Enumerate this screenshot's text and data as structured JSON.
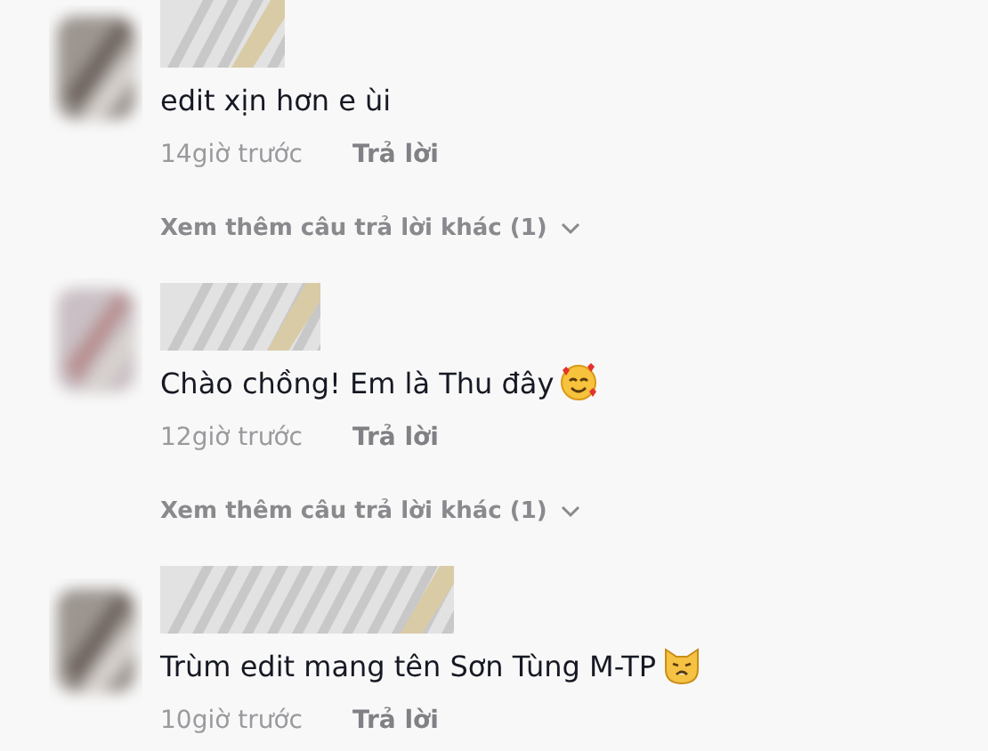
{
  "comments": [
    {
      "text": "edit xịn hơn e ùi",
      "time": "14giờ trước",
      "reply": "Trả lời",
      "more_replies": "Xem thêm câu trả lời khác (1)"
    },
    {
      "text": "Chào chồng! Em là Thu đây",
      "emoji": {
        "kind": "hearts"
      },
      "time": "12giờ trước",
      "reply": "Trả lời",
      "more_replies": "Xem thêm câu trả lời khác (1)"
    },
    {
      "text": "Trùm edit mang tên Sơn Tùng M-TP",
      "emoji": {
        "kind": "cat"
      },
      "time": "10giờ trước",
      "reply": "Trả lời"
    }
  ]
}
